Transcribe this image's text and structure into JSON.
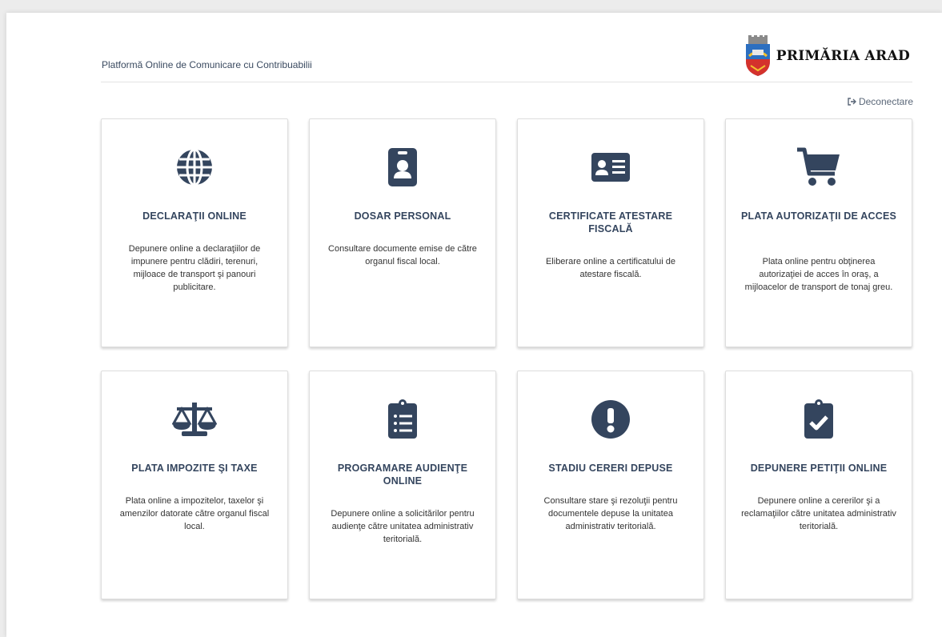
{
  "header": {
    "platform_title": "Platformă Online de Comunicare cu Contribuabilii",
    "logo_text": "PRIMĂRIA ARAD"
  },
  "logout_label": "Deconectare",
  "icon_color": "#34455e",
  "cards": [
    {
      "title": "DECLARAŢII ONLINE",
      "description": "Depunere online a declaraţiilor de impunere pentru clădiri, terenuri, mijloace de transport şi panouri publicitare.",
      "icon": "globe-icon"
    },
    {
      "title": "DOSAR PERSONAL",
      "description": "Consultare documente emise de către organul fiscal local.",
      "icon": "id-badge-icon"
    },
    {
      "title": "CERTIFICATE ATESTARE FISCALĂ",
      "description": "Eliberare online a certificatului de atestare fiscală.",
      "icon": "id-card-icon"
    },
    {
      "title": "PLATA AUTORIZAŢII DE ACCES",
      "description": "Plata online pentru obţinerea autorizaţiei de acces în oraş, a mijloacelor de transport de tonaj greu.",
      "icon": "shopping-cart-icon"
    },
    {
      "title": "PLATA IMPOZITE ŞI TAXE",
      "description": "Plata online a impozitelor, taxelor şi amenzilor datorate către organul fiscal local.",
      "icon": "balance-scale-icon"
    },
    {
      "title": "PROGRAMARE AUDIENŢE ONLINE",
      "description": "Depunere online a solicitărilor pentru audienţe către unitatea administrativ teritorială.",
      "icon": "clipboard-list-icon"
    },
    {
      "title": "STADIU CERERI DEPUSE",
      "description": "Consultare stare şi rezoluţii pentru documentele depuse la unitatea administrativ teritorială.",
      "icon": "exclamation-circle-icon"
    },
    {
      "title": "DEPUNERE PETIŢII ONLINE",
      "description": "Depunere online a cererilor şi a reclamaţiilor către unitatea administrativ teritorială.",
      "icon": "clipboard-check-icon"
    }
  ]
}
